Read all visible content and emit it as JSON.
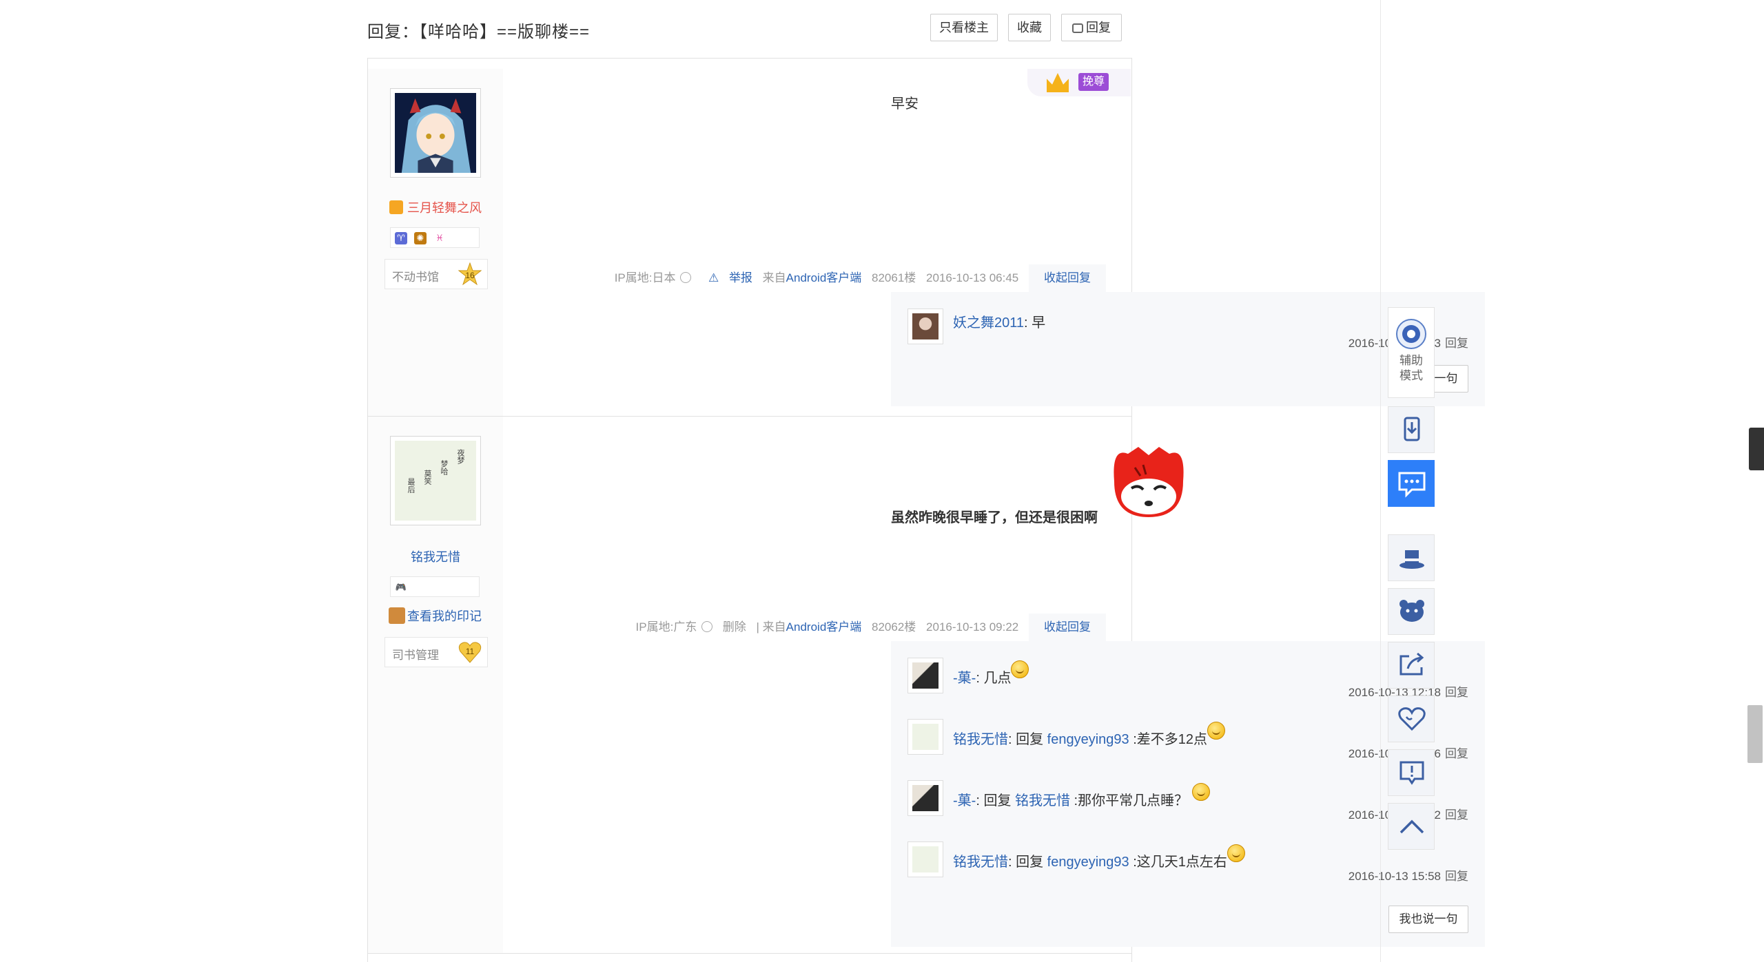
{
  "header": {
    "title": "回复：【咩哈哈】==版聊楼==",
    "buttons": {
      "only_op": "只看楼主",
      "favorite": "收藏",
      "reply": "回复"
    }
  },
  "posts": [
    {
      "user": {
        "name": "三月轻舞之风",
        "level_title": "不动书馆",
        "level": "16"
      },
      "vip_tag": "挽尊",
      "content": "早安",
      "meta": {
        "ip": "IP属地:日本",
        "report": "举报",
        "client_prefix": "来自",
        "client": "Android客户端",
        "floor": "82061楼",
        "time": "2016-10-13 06:45",
        "fold": "收起回复"
      },
      "replies": [
        {
          "user": "妖之舞2011",
          "text": ": 早",
          "time": "2016-10-13 07:03",
          "reply_label": "回复"
        }
      ],
      "say_button": "我也说一句"
    },
    {
      "user": {
        "name": "铭我无惜",
        "imprint": "查看我的印记",
        "level_title": "司书管理",
        "level": "11",
        "avatar_text": [
          "夜梦",
          "梦哈",
          "莫笑",
          "最后"
        ]
      },
      "content": "虽然昨晚很早睡了，但还是很困啊",
      "meta": {
        "ip": "IP属地:广东",
        "delete": "删除",
        "client_prefix": "| 来自",
        "client": "Android客户端",
        "floor": "82062楼",
        "time": "2016-10-13 09:22",
        "fold": "收起回复"
      },
      "replies": [
        {
          "user": "-菓-",
          "reply_prefix": "",
          "target": "",
          "text": ": 几点",
          "time": "2016-10-13 12:18",
          "reply_label": "回复"
        },
        {
          "user": "铭我无惜",
          "reply_prefix": ": 回复 ",
          "target": "fengyeying93",
          "text": " :差不多12点",
          "time": "2016-10-13 14:06",
          "reply_label": "回复"
        },
        {
          "user": "-菓-",
          "reply_prefix": ": 回复 ",
          "target": "铭我无惜",
          "text": " :那你平常几点睡？",
          "time": "2016-10-13 14:12",
          "reply_label": "回复"
        },
        {
          "user": "铭我无惜",
          "reply_prefix": ": 回复 ",
          "target": "fengyeying93",
          "text": " :这几天1点左右",
          "time": "2016-10-13 15:58",
          "reply_label": "回复"
        }
      ],
      "say_button": "我也说一句"
    }
  ],
  "toolbar": {
    "assist": "辅助模式",
    "icons": [
      "assist-mode-icon",
      "download-app-icon",
      "comment-icon",
      "magic-hat-icon",
      "bear-face-icon",
      "share-icon",
      "like-heart-icon",
      "report-icon",
      "back-to-top-icon"
    ],
    "active_color": "#2d7ff9"
  }
}
